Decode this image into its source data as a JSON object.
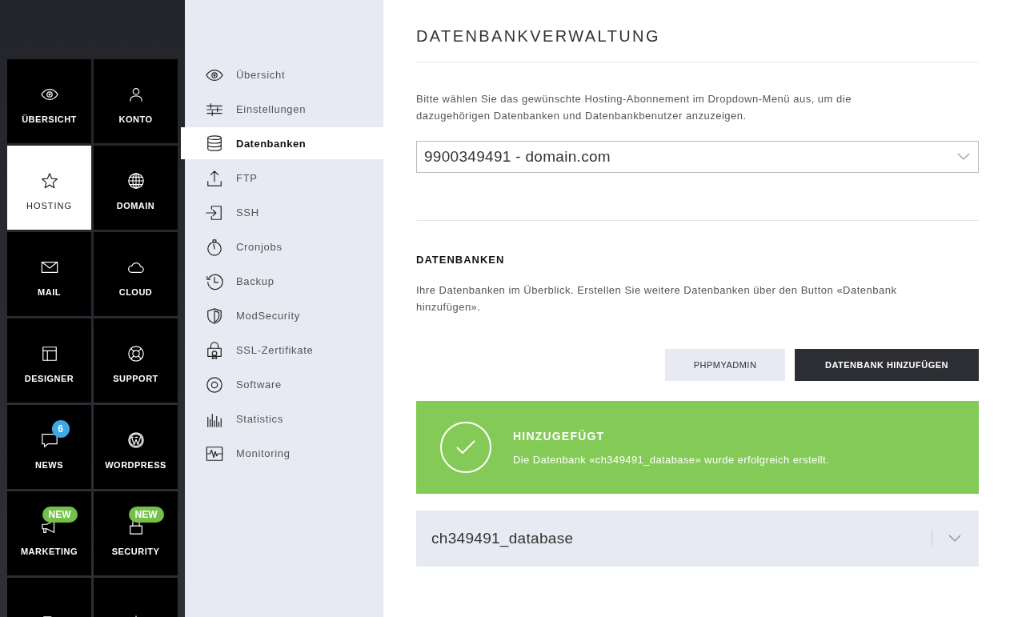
{
  "tiles": [
    {
      "kind": "eye",
      "label": "ÜBERSICHT",
      "selected": false
    },
    {
      "kind": "person",
      "label": "KONTO",
      "selected": false
    },
    {
      "kind": "star",
      "label": "HOSTING",
      "selected": true
    },
    {
      "kind": "globe",
      "label": "DOMAIN",
      "selected": false
    },
    {
      "kind": "envelope",
      "label": "MAIL",
      "selected": false
    },
    {
      "kind": "cloud",
      "label": "CLOUD",
      "selected": false
    },
    {
      "kind": "layout",
      "label": "DESIGNER",
      "selected": false
    },
    {
      "kind": "lifebuoy",
      "label": "SUPPORT",
      "selected": false
    },
    {
      "kind": "chat",
      "label": "NEWS",
      "selected": false,
      "badge": {
        "kind": "count",
        "text": "6"
      }
    },
    {
      "kind": "wordpress",
      "label": "WORDPRESS",
      "selected": false
    },
    {
      "kind": "megaphone",
      "label": "MARKETING",
      "selected": false,
      "badge": {
        "kind": "new",
        "text": "NEW"
      }
    },
    {
      "kind": "lock",
      "label": "SECURITY",
      "selected": false,
      "badge": {
        "kind": "new",
        "text": "NEW"
      }
    },
    {
      "kind": "exit",
      "selected": false
    },
    {
      "kind": "power",
      "selected": false
    }
  ],
  "nav": [
    {
      "kind": "eye",
      "label": "Übersicht",
      "selected": false
    },
    {
      "kind": "sliders",
      "label": "Einstellungen",
      "selected": false
    },
    {
      "kind": "database",
      "label": "Datenbanken",
      "selected": true
    },
    {
      "kind": "upload",
      "label": "FTP",
      "selected": false
    },
    {
      "kind": "login",
      "label": "SSH",
      "selected": false
    },
    {
      "kind": "stopwatch",
      "label": "Cronjobs",
      "selected": false
    },
    {
      "kind": "history",
      "label": "Backup",
      "selected": false
    },
    {
      "kind": "shield",
      "label": "ModSecurity",
      "selected": false
    },
    {
      "kind": "certificate",
      "label": "SSL-Zertifikate",
      "selected": false
    },
    {
      "kind": "disc",
      "label": "Software",
      "selected": false
    },
    {
      "kind": "bars",
      "label": "Statistics",
      "selected": false
    },
    {
      "kind": "pulse",
      "label": "Monitoring",
      "selected": false
    }
  ],
  "main": {
    "title": "DATENBANKVERWALTUNG",
    "intro": "Bitte wählen Sie das gewünschte Hosting-Abonnement im Dropdown-Menü aus, um die dazugehörigen Datenbanken und Datenbankbenutzer anzuzeigen.",
    "subscription_select": {
      "value": "9900349491 - domain.com"
    },
    "section_title": "DATENBANKEN",
    "section_text": "Ihre Datenbanken im Überblick. Erstellen Sie weitere Datenbanken über den Button «Datenbank hinzufügen».",
    "buttons": [
      {
        "kind": "secondary",
        "label": "PHPMYADMIN"
      },
      {
        "kind": "primary",
        "label": "DATENBANK HINZUFÜGEN"
      }
    ],
    "alert": {
      "title": "HINZUGEFÜGT",
      "message": "Die Datenbank «ch349491_database» wurde erfolgreich erstellt."
    },
    "databases": [
      {
        "name": "ch349491_database",
        "expanded": false
      }
    ]
  }
}
